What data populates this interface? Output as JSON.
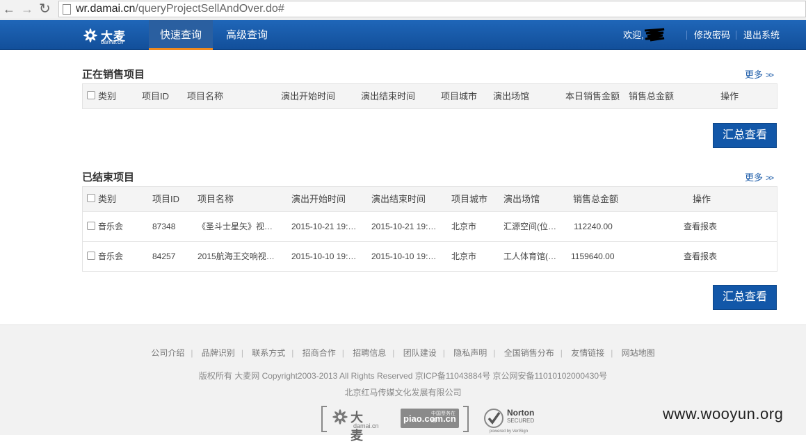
{
  "browser": {
    "url_host": "wr.damai.cn",
    "url_path": "/queryProjectSellAndOver.do#"
  },
  "nav": {
    "logo_cn": "大麦",
    "logo_en": "damai.cn",
    "tabs": [
      {
        "label": "快速查询",
        "active": true
      },
      {
        "label": "高级查询",
        "active": false
      }
    ],
    "welcome": "欢迎,",
    "change_password": "修改密码",
    "logout": "退出系统"
  },
  "on_sale": {
    "title": "正在销售项目",
    "more": "更多",
    "columns": [
      "类别",
      "项目ID",
      "项目名称",
      "演出开始时间",
      "演出结束时间",
      "项目城市",
      "演出场馆",
      "本日销售金额",
      "销售总金额",
      "操作"
    ],
    "summary_button": "汇总查看"
  },
  "ended": {
    "title": "已结束项目",
    "more": "更多",
    "columns": [
      "类别",
      "项目ID",
      "项目名称",
      "演出开始时间",
      "演出结束时间",
      "项目城市",
      "演出场馆",
      "销售总金额",
      "操作"
    ],
    "rows": [
      {
        "category": "音乐会",
        "id": "87348",
        "name": "《圣斗士星矢》视…",
        "start": "2015-10-21 19:…",
        "end": "2015-10-21 19:…",
        "city": "北京市",
        "venue": "汇源空间(位…",
        "total": "112240.00",
        "action": "查看报表"
      },
      {
        "category": "音乐会",
        "id": "84257",
        "name": "2015航海王交响视…",
        "start": "2015-10-10 19:…",
        "end": "2015-10-10 19:…",
        "city": "北京市",
        "venue": "工人体育馆(…",
        "total": "1159640.00",
        "action": "查看报表"
      }
    ],
    "summary_button": "汇总查看"
  },
  "footer": {
    "links": [
      "公司介绍",
      "品牌识别",
      "联系方式",
      "招商合作",
      "招聘信息",
      "团队建设",
      "隐私声明",
      "全国销售分布",
      "友情链接",
      "网站地图"
    ],
    "copyright": "版权所有 大麦网 Copyright2003-2013 All Rights Reserved 京ICP备11043884号 京公网安备11010102000430号",
    "company": "北京红马传媒文化发展有限公司",
    "badges": {
      "damai_cn": "大麦",
      "damai_en": "damai.cn",
      "piao": "piao.com.cn",
      "piao_sub": "中国票务在线",
      "norton": "Norton",
      "norton_secured": "SECURED",
      "norton_powered": "powered by VeriSign"
    }
  },
  "watermark": "www.wooyun.org"
}
